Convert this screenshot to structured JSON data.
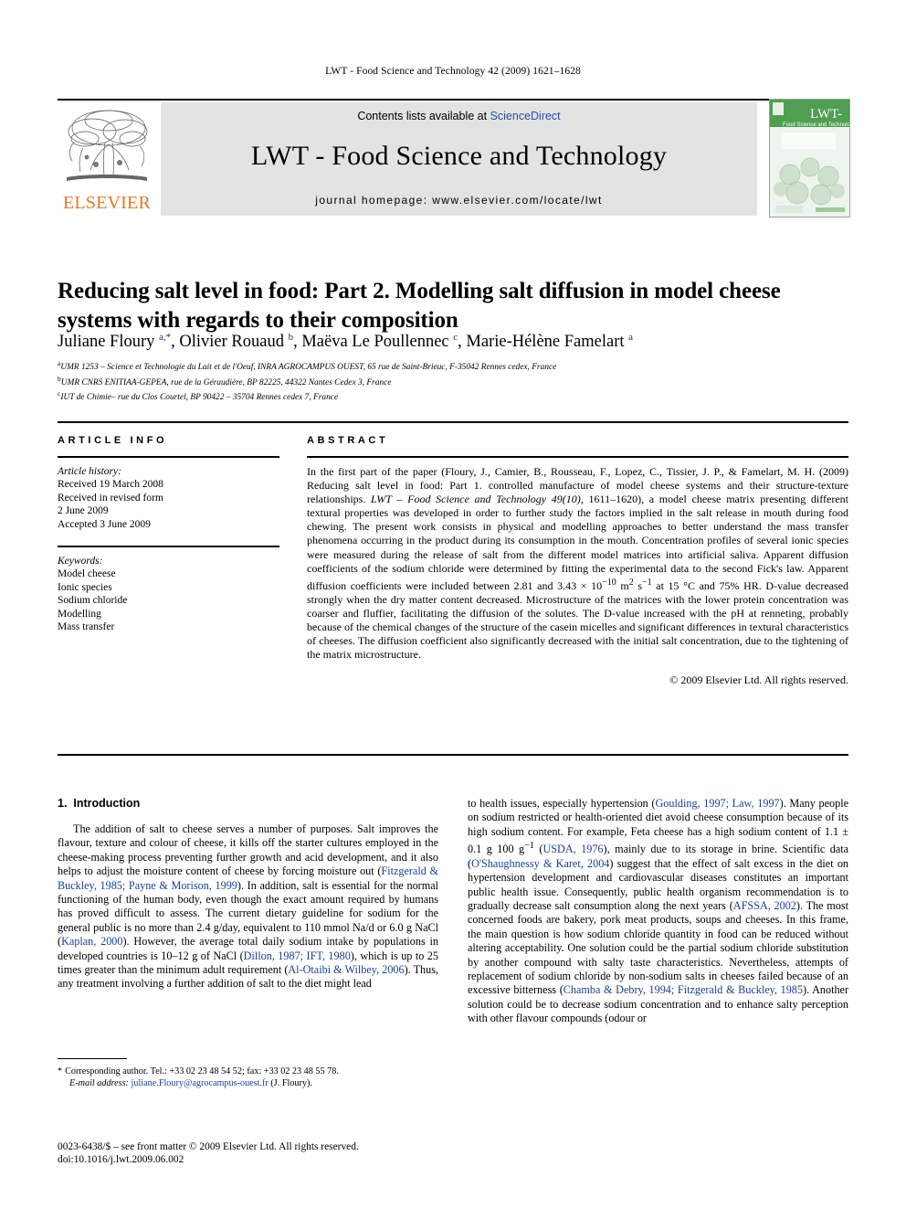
{
  "running_head": "LWT - Food Science and Technology 42 (2009) 1621–1628",
  "masthead": {
    "contents_prefix": "Contents lists available at ",
    "sciencedirect": "ScienceDirect",
    "journal_title": "LWT - Food Science and Technology",
    "homepage": "journal homepage: www.elsevier.com/locate/lwt",
    "publisher_wordmark": "ELSEVIER",
    "cover_title": "LWT-",
    "cover_subtitle": "Food Science and Technology"
  },
  "article": {
    "title": "Reducing salt level in food: Part 2. Modelling salt diffusion in model cheese systems with regards to their composition",
    "authors_html": "Juliane Floury <sup>a,*</sup>, Olivier Rouaud <sup>b</sup>, Maëva Le Poullennec <sup>c</sup>, Marie-Hélène Famelart <sup>a</sup>",
    "affiliations": [
      "UMR 1253 – Science et Technologie du Lait et de l'Oeuf, INRA AGROCAMPUS OUEST, 65 rue de Saint-Brieuc, F-35042 Rennes cedex, France",
      "UMR CNRS ENITIAA-GEPEA, rue de la Géraudière, BP 82225, 44322 Nantes Cedex 3, France",
      "IUT de Chimie– rue du Clos Courtel, BP 90422 – 35704 Rennes cedex 7, France"
    ],
    "affiliation_marks": [
      "a",
      "b",
      "c"
    ]
  },
  "info": {
    "heading": "ARTICLE INFO",
    "history_label": "Article history:",
    "history": [
      "Received 19 March 2008",
      "Received in revised form",
      "2 June 2009",
      "Accepted 3 June 2009"
    ],
    "keywords_label": "Keywords:",
    "keywords": [
      "Model cheese",
      "Ionic species",
      "Sodium chloride",
      "Modelling",
      "Mass transfer"
    ]
  },
  "abstract": {
    "heading": "ABSTRACT",
    "part1": "In the first part of the paper (Floury, J., Camier, B., Rousseau, F., Lopez, C., Tissier, J. P., & Famelart, M. H. (2009) Reducing salt level in food: Part 1. controlled manufacture of model cheese systems and their structure-texture relationships. ",
    "journal_italic": "LWT – Food Science and Technology 49(10)",
    "part2": ", 1611–1620), a model cheese matrix presenting different textural properties was developed in order to further study the factors implied in the salt release in mouth during food chewing. The present work consists in physical and modelling approaches to better understand the mass transfer phenomena occurring in the product during its consumption in the mouth. Concentration profiles of several ionic species were measured during the release of salt from the different model matrices into artificial saliva. Apparent diffusion coefficients of the sodium chloride were determined by fitting the experimental data to the second Fick's law. Apparent diffusion coefficients were included between 2.81 and 3.43 × 10",
    "exp1": "−10",
    "part3": " m",
    "exp2": "2",
    "part4": " s",
    "exp3": "−1",
    "part5": " at 15 °C and 75% HR. D-value decreased strongly when the dry matter content decreased. Microstructure of the matrices with the lower protein concentration was coarser and fluffier, facilitating the diffusion of the solutes. The D-value increased with the pH at renneting, probably because of the chemical changes of the structure of the casein micelles and significant differences in textural characteristics of cheeses. The diffusion coefficient also significantly decreased with the initial salt concentration, due to the tightening of the matrix microstructure.",
    "copyright": "© 2009 Elsevier Ltd. All rights reserved."
  },
  "introduction": {
    "section_number": "1.",
    "section_title": "Introduction",
    "left_para_1": "The addition of salt to cheese serves a number of purposes. Salt improves the flavour, texture and colour of cheese, it kills off the starter cultures employed in the cheese-making process preventing further growth and acid development, and it also helps to adjust the moisture content of cheese by forcing moisture out (",
    "left_ref_1": "Fitzgerald & Buckley, 1985; Payne & Morison, 1999",
    "left_para_2": "). In addition, salt is essential for the normal functioning of the human body, even though the exact amount required by humans has proved difficult to assess. The current dietary guideline for sodium for the general public is no more than 2.4 g/day, equivalent to 110 mmol Na/d or 6.0 g NaCl (",
    "left_ref_2": "Kaplan, 2000",
    "left_para_3": "). However, the average total daily sodium intake by populations in developed countries is 10–12 g of NaCl (",
    "left_ref_3": "Dillon, 1987; IFT, 1980",
    "left_para_4": "), which is up to 25 times greater than the minimum adult requirement (",
    "left_ref_4": "Al-Otaibi & Wilbey, 2006",
    "left_para_5": "). Thus, any treatment involving a further addition of salt to the diet might lead",
    "right_para_1": "to health issues, especially hypertension (",
    "right_ref_1": "Goulding, 1997; Law, 1997",
    "right_para_2": "). Many people on sodium restricted or health-oriented diet avoid cheese consumption because of its high sodium content. For example, Feta cheese has a high sodium content of 1.1 ± 0.1 g 100 g",
    "right_exp_1": "−1",
    "right_para_3": " (",
    "right_ref_2": "USDA, 1976",
    "right_para_4": "), mainly due to its storage in brine. Scientific data (",
    "right_ref_3": "O'Shaughnessy & Karet, 2004",
    "right_para_5": ") suggest that the effect of salt excess in the diet on hypertension development and cardiovascular diseases constitutes an important public health issue. Consequently, public health organism recommendation is to gradually decrease salt consumption along the next years (",
    "right_ref_4": "AFSSA, 2002",
    "right_para_6": "). The most concerned foods are bakery, pork meat products, soups and cheeses. In this frame, the main question is how sodium chloride quantity in food can be reduced without altering acceptability. One solution could be the partial sodium chloride substitution by another compound with salty taste characteristics. Nevertheless, attempts of replacement of sodium chloride by non-sodium salts in cheeses failed because of an excessive bitterness (",
    "right_ref_5": "Chamba & Debry, 1994; Fitzgerald & Buckley, 1985",
    "right_para_7": "). Another solution could be to decrease sodium concentration and to enhance salty perception with other flavour compounds (odour or"
  },
  "footnote": {
    "star": "*",
    "text": "Corresponding author. Tel.: +33 02 23 48 54 52; fax: +33 02 23 48 55 78.",
    "email_label": "E-mail address:",
    "email": "juliane.Floury@agrocampus-ouest.fr",
    "email_suffix": "(J. Floury)."
  },
  "colophon": {
    "line1": "0023-6438/$ – see front matter © 2009 Elsevier Ltd. All rights reserved.",
    "line2": "doi:10.1016/j.lwt.2009.06.002"
  },
  "colors": {
    "elsevier_orange": "#E87722",
    "link_blue": "#2a4ea8",
    "reference_blue": "#1c3f94",
    "masthead_gray": "#e3e3e3"
  }
}
